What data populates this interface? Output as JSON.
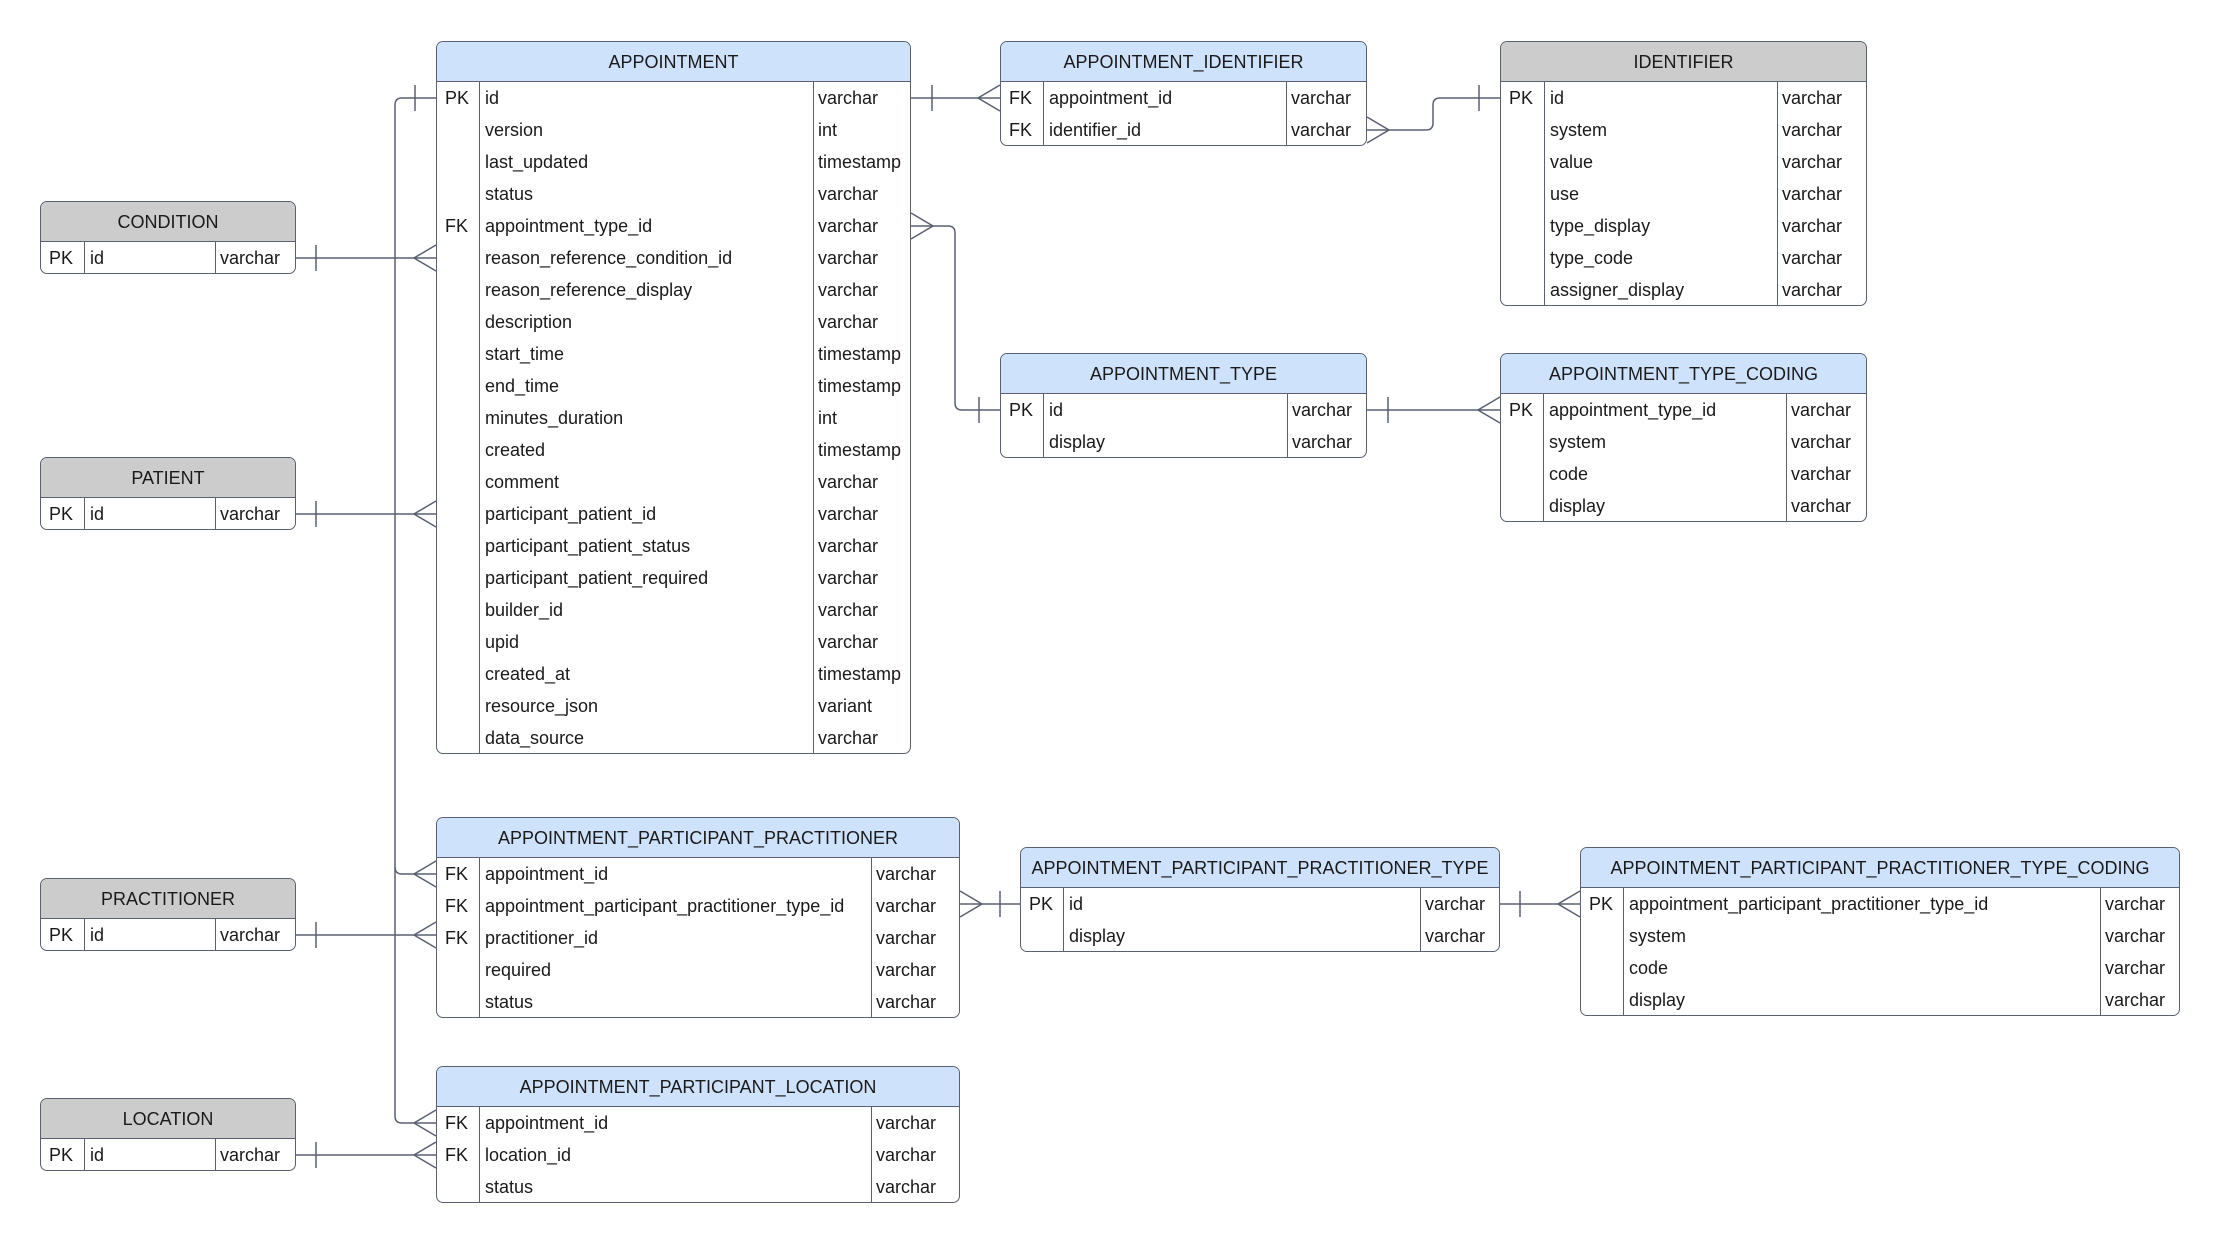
{
  "diagram": {
    "type": "entity-relationship",
    "colors": {
      "entity_header": "#cfe2fb",
      "reference_header": "#cccccc",
      "border": "#5a6070"
    }
  },
  "entities": [
    {
      "id": "appointment",
      "title": "APPOINTMENT",
      "style": "blue",
      "fields": [
        {
          "key": "PK",
          "name": "id",
          "type": "varchar"
        },
        {
          "key": "",
          "name": "version",
          "type": "int"
        },
        {
          "key": "",
          "name": "last_updated",
          "type": "timestamp"
        },
        {
          "key": "",
          "name": "status",
          "type": "varchar"
        },
        {
          "key": "FK",
          "name": "appointment_type_id",
          "type": "varchar"
        },
        {
          "key": "",
          "name": "reason_reference_condition_id",
          "type": "varchar"
        },
        {
          "key": "",
          "name": "reason_reference_display",
          "type": "varchar"
        },
        {
          "key": "",
          "name": "description",
          "type": "varchar"
        },
        {
          "key": "",
          "name": "start_time",
          "type": "timestamp"
        },
        {
          "key": "",
          "name": "end_time",
          "type": "timestamp"
        },
        {
          "key": "",
          "name": "minutes_duration",
          "type": "int"
        },
        {
          "key": "",
          "name": "created",
          "type": "timestamp"
        },
        {
          "key": "",
          "name": "comment",
          "type": "varchar"
        },
        {
          "key": "",
          "name": "participant_patient_id",
          "type": "varchar"
        },
        {
          "key": "",
          "name": "participant_patient_status",
          "type": "varchar"
        },
        {
          "key": "",
          "name": "participant_patient_required",
          "type": "varchar"
        },
        {
          "key": "",
          "name": "builder_id",
          "type": "varchar"
        },
        {
          "key": "",
          "name": "upid",
          "type": "varchar"
        },
        {
          "key": "",
          "name": "created_at",
          "type": "timestamp"
        },
        {
          "key": "",
          "name": "resource_json",
          "type": "variant"
        },
        {
          "key": "",
          "name": "data_source",
          "type": "varchar"
        }
      ]
    },
    {
      "id": "appointment_identifier",
      "title": "APPOINTMENT_IDENTIFIER",
      "style": "blue",
      "fields": [
        {
          "key": "FK",
          "name": "appointment_id",
          "type": "varchar"
        },
        {
          "key": "FK",
          "name": "identifier_id",
          "type": "varchar"
        }
      ]
    },
    {
      "id": "identifier",
      "title": "IDENTIFIER",
      "style": "gray",
      "fields": [
        {
          "key": "PK",
          "name": "id",
          "type": "varchar"
        },
        {
          "key": "",
          "name": "system",
          "type": "varchar"
        },
        {
          "key": "",
          "name": "value",
          "type": "varchar"
        },
        {
          "key": "",
          "name": "use",
          "type": "varchar"
        },
        {
          "key": "",
          "name": "type_display",
          "type": "varchar"
        },
        {
          "key": "",
          "name": "type_code",
          "type": "varchar"
        },
        {
          "key": "",
          "name": "assigner_display",
          "type": "varchar"
        }
      ]
    },
    {
      "id": "condition",
      "title": "CONDITION",
      "style": "gray",
      "fields": [
        {
          "key": "PK",
          "name": "id",
          "type": "varchar"
        }
      ]
    },
    {
      "id": "patient",
      "title": "PATIENT",
      "style": "gray",
      "fields": [
        {
          "key": "PK",
          "name": "id",
          "type": "varchar"
        }
      ]
    },
    {
      "id": "practitioner",
      "title": "PRACTITIONER",
      "style": "gray",
      "fields": [
        {
          "key": "PK",
          "name": "id",
          "type": "varchar"
        }
      ]
    },
    {
      "id": "location",
      "title": "LOCATION",
      "style": "gray",
      "fields": [
        {
          "key": "PK",
          "name": "id",
          "type": "varchar"
        }
      ]
    },
    {
      "id": "appointment_type",
      "title": "APPOINTMENT_TYPE",
      "style": "blue",
      "fields": [
        {
          "key": "PK",
          "name": "id",
          "type": "varchar"
        },
        {
          "key": "",
          "name": "display",
          "type": "varchar"
        }
      ]
    },
    {
      "id": "appointment_type_coding",
      "title": "APPOINTMENT_TYPE_CODING",
      "style": "blue",
      "fields": [
        {
          "key": "PK",
          "name": "appointment_type_id",
          "type": "varchar"
        },
        {
          "key": "",
          "name": "system",
          "type": "varchar"
        },
        {
          "key": "",
          "name": "code",
          "type": "varchar"
        },
        {
          "key": "",
          "name": "display",
          "type": "varchar"
        }
      ]
    },
    {
      "id": "appointment_participant_practitioner",
      "title": "APPOINTMENT_PARTICIPANT_PRACTITIONER",
      "style": "blue",
      "fields": [
        {
          "key": "FK",
          "name": "appointment_id",
          "type": "varchar"
        },
        {
          "key": "FK",
          "name": "appointment_participant_practitioner_type_id",
          "type": "varchar"
        },
        {
          "key": "FK",
          "name": "practitioner_id",
          "type": "varchar"
        },
        {
          "key": "",
          "name": "required",
          "type": "varchar"
        },
        {
          "key": "",
          "name": "status",
          "type": "varchar"
        }
      ]
    },
    {
      "id": "appointment_participant_practitioner_type",
      "title": "APPOINTMENT_PARTICIPANT_PRACTITIONER_TYPE",
      "style": "blue",
      "fields": [
        {
          "key": "PK",
          "name": "id",
          "type": "varchar"
        },
        {
          "key": "",
          "name": "display",
          "type": "varchar"
        }
      ]
    },
    {
      "id": "appointment_participant_practitioner_type_coding",
      "title": "APPOINTMENT_PARTICIPANT_PRACTITIONER_TYPE_CODING",
      "style": "blue",
      "fields": [
        {
          "key": "PK",
          "name": "appointment_participant_practitioner_type_id",
          "type": "varchar"
        },
        {
          "key": "",
          "name": "system",
          "type": "varchar"
        },
        {
          "key": "",
          "name": "code",
          "type": "varchar"
        },
        {
          "key": "",
          "name": "display",
          "type": "varchar"
        }
      ]
    },
    {
      "id": "appointment_participant_location",
      "title": "APPOINTMENT_PARTICIPANT_LOCATION",
      "style": "blue",
      "fields": [
        {
          "key": "FK",
          "name": "appointment_id",
          "type": "varchar"
        },
        {
          "key": "FK",
          "name": "location_id",
          "type": "varchar"
        },
        {
          "key": "",
          "name": "status",
          "type": "varchar"
        }
      ]
    }
  ],
  "relationships": [
    {
      "from": "appointment.id",
      "to": "appointment_identifier.appointment_id",
      "cardinality": "one-to-many"
    },
    {
      "from": "identifier.id",
      "to": "appointment_identifier.identifier_id",
      "cardinality": "one-to-many"
    },
    {
      "from": "appointment_type.id",
      "to": "appointment.appointment_type_id",
      "cardinality": "one-to-many"
    },
    {
      "from": "appointment_type.id",
      "to": "appointment_type_coding.appointment_type_id",
      "cardinality": "one-to-many"
    },
    {
      "from": "condition.id",
      "to": "appointment.reason_reference_condition_id",
      "cardinality": "one-to-many"
    },
    {
      "from": "patient.id",
      "to": "appointment.participant_patient_id",
      "cardinality": "one-to-many"
    },
    {
      "from": "appointment.id",
      "to": "appointment_participant_practitioner.appointment_id",
      "cardinality": "one-to-many"
    },
    {
      "from": "practitioner.id",
      "to": "appointment_participant_practitioner.practitioner_id",
      "cardinality": "one-to-many"
    },
    {
      "from": "appointment_participant_practitioner_type.id",
      "to": "appointment_participant_practitioner.appointment_participant_practitioner_type_id",
      "cardinality": "one-to-many"
    },
    {
      "from": "appointment_participant_practitioner_type.id",
      "to": "appointment_participant_practitioner_type_coding.appointment_participant_practitioner_type_id",
      "cardinality": "one-to-many"
    },
    {
      "from": "appointment.id",
      "to": "appointment_participant_location.appointment_id",
      "cardinality": "one-to-many"
    },
    {
      "from": "location.id",
      "to": "appointment_participant_location.location_id",
      "cardinality": "one-to-many"
    }
  ]
}
